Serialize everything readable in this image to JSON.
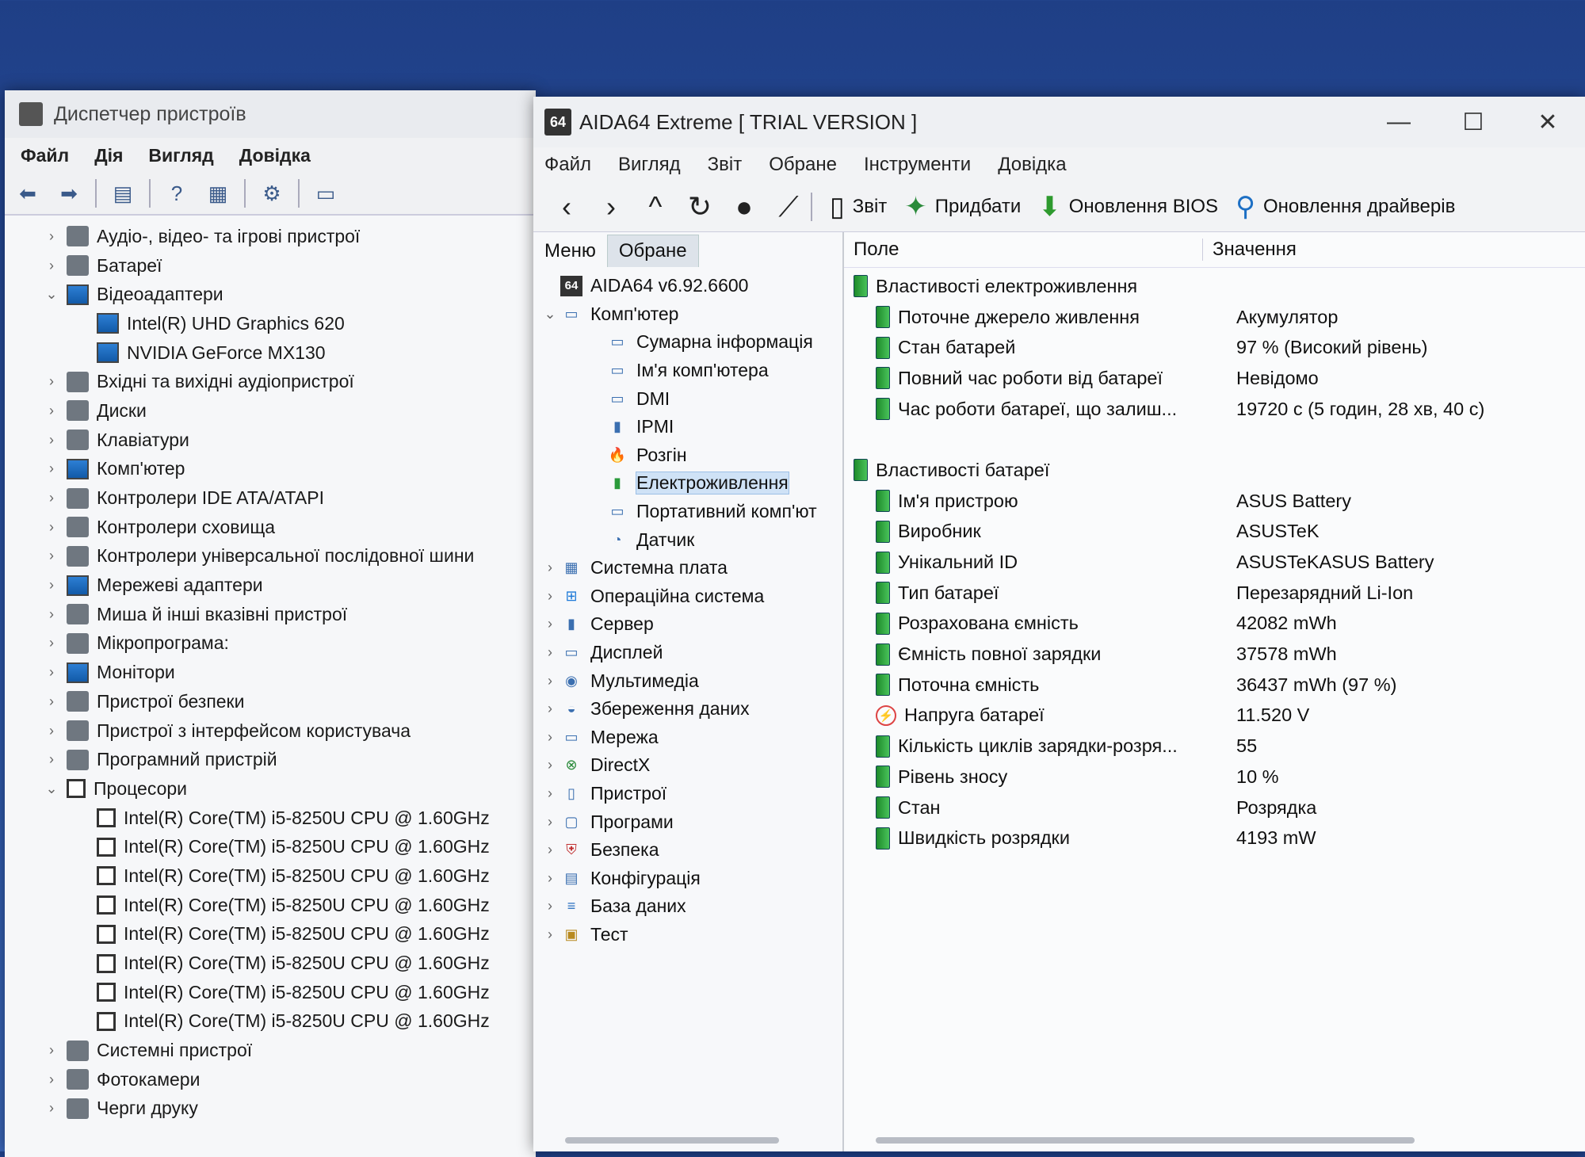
{
  "device_manager": {
    "title": "Диспетчер пристроїв",
    "menu": [
      "Файл",
      "Дія",
      "Вигляд",
      "Довідка"
    ],
    "tree": [
      {
        "label": "Аудіо-, відео- та ігрові пристрої",
        "level": 0,
        "expander": "›",
        "icon": "speaker-icon"
      },
      {
        "label": "Батареї",
        "level": 0,
        "expander": "›",
        "icon": "battery-icon"
      },
      {
        "label": "Відеоадаптери",
        "level": 0,
        "expander": "⌄",
        "icon": "display-adapter-icon"
      },
      {
        "label": "Intel(R) UHD Graphics 620",
        "level": 1,
        "expander": "",
        "icon": "display-adapter-icon"
      },
      {
        "label": "NVIDIA GeForce MX130",
        "level": 1,
        "expander": "",
        "icon": "display-adapter-icon"
      },
      {
        "label": "Вхідні та вихідні аудіопристрої",
        "level": 0,
        "expander": "›",
        "icon": "speaker-icon"
      },
      {
        "label": "Диски",
        "level": 0,
        "expander": "›",
        "icon": "disk-icon"
      },
      {
        "label": "Клавіатури",
        "level": 0,
        "expander": "›",
        "icon": "keyboard-icon"
      },
      {
        "label": "Комп'ютер",
        "level": 0,
        "expander": "›",
        "icon": "computer-icon"
      },
      {
        "label": "Контролери IDE ATA/ATAPI",
        "level": 0,
        "expander": "›",
        "icon": "ide-controller-icon"
      },
      {
        "label": "Контролери сховища",
        "level": 0,
        "expander": "›",
        "icon": "storage-controller-icon"
      },
      {
        "label": "Контролери універсальної послідовної шини",
        "level": 0,
        "expander": "›",
        "icon": "usb-icon"
      },
      {
        "label": "Мережеві адаптери",
        "level": 0,
        "expander": "›",
        "icon": "network-adapter-icon"
      },
      {
        "label": "Миша й інші вказівні пристрої",
        "level": 0,
        "expander": "›",
        "icon": "mouse-icon"
      },
      {
        "label": "Мікропрограма:",
        "level": 0,
        "expander": "›",
        "icon": "firmware-icon"
      },
      {
        "label": "Монітори",
        "level": 0,
        "expander": "›",
        "icon": "monitor-icon"
      },
      {
        "label": "Пристрої безпеки",
        "level": 0,
        "expander": "›",
        "icon": "security-device-icon"
      },
      {
        "label": "Пристрої з інтерфейсом користувача",
        "level": 0,
        "expander": "›",
        "icon": "hid-icon"
      },
      {
        "label": "Програмний пристрій",
        "level": 0,
        "expander": "›",
        "icon": "software-device-icon"
      },
      {
        "label": "Процесори",
        "level": 0,
        "expander": "⌄",
        "icon": "cpu-icon"
      },
      {
        "label": "Intel(R) Core(TM) i5-8250U CPU @ 1.60GHz",
        "level": 1,
        "expander": "",
        "icon": "cpu-icon"
      },
      {
        "label": "Intel(R) Core(TM) i5-8250U CPU @ 1.60GHz",
        "level": 1,
        "expander": "",
        "icon": "cpu-icon"
      },
      {
        "label": "Intel(R) Core(TM) i5-8250U CPU @ 1.60GHz",
        "level": 1,
        "expander": "",
        "icon": "cpu-icon"
      },
      {
        "label": "Intel(R) Core(TM) i5-8250U CPU @ 1.60GHz",
        "level": 1,
        "expander": "",
        "icon": "cpu-icon"
      },
      {
        "label": "Intel(R) Core(TM) i5-8250U CPU @ 1.60GHz",
        "level": 1,
        "expander": "",
        "icon": "cpu-icon"
      },
      {
        "label": "Intel(R) Core(TM) i5-8250U CPU @ 1.60GHz",
        "level": 1,
        "expander": "",
        "icon": "cpu-icon"
      },
      {
        "label": "Intel(R) Core(TM) i5-8250U CPU @ 1.60GHz",
        "level": 1,
        "expander": "",
        "icon": "cpu-icon"
      },
      {
        "label": "Intel(R) Core(TM) i5-8250U CPU @ 1.60GHz",
        "level": 1,
        "expander": "",
        "icon": "cpu-icon"
      },
      {
        "label": "Системні пристрої",
        "level": 0,
        "expander": "›",
        "icon": "system-device-icon"
      },
      {
        "label": "Фотокамери",
        "level": 0,
        "expander": "›",
        "icon": "camera-icon"
      },
      {
        "label": "Черги друку",
        "level": 0,
        "expander": "›",
        "icon": "printer-icon"
      }
    ]
  },
  "aida": {
    "title": "AIDA64 Extreme  [ TRIAL VERSION ]",
    "logo_text": "64",
    "window_controls": [
      "—",
      "☐",
      "✕"
    ],
    "menu": [
      "Файл",
      "Вигляд",
      "Звіт",
      "Обране",
      "Інструменти",
      "Довідка"
    ],
    "toolbar": {
      "report": "Звіт",
      "buy": "Придбати",
      "bios_update": "Оновлення BIOS",
      "driver_update": "Оновлення драйверів"
    },
    "tabs": {
      "menu": "Меню",
      "favorites": "Обране"
    },
    "nav_tree": [
      {
        "label": "AIDA64 v6.92.6600",
        "level": 0,
        "expander": "",
        "icon": "aida64-icon"
      },
      {
        "label": "Комп'ютер",
        "level": 0,
        "expander": "⌄",
        "icon": "computer-icon"
      },
      {
        "label": "Сумарна інформація",
        "level": 1,
        "expander": "",
        "icon": "computer-icon"
      },
      {
        "label": "Ім'я комп'ютера",
        "level": 1,
        "expander": "",
        "icon": "computer-icon"
      },
      {
        "label": "DMI",
        "level": 1,
        "expander": "",
        "icon": "computer-icon"
      },
      {
        "label": "IPMI",
        "level": 1,
        "expander": "",
        "icon": "server-icon"
      },
      {
        "label": "Розгін",
        "level": 1,
        "expander": "",
        "icon": "flame-icon"
      },
      {
        "label": "Електроживлення",
        "level": 1,
        "expander": "",
        "icon": "battery-icon",
        "selected": true
      },
      {
        "label": "Портативний комп'ют",
        "level": 1,
        "expander": "",
        "icon": "computer-icon"
      },
      {
        "label": "Датчик",
        "level": 1,
        "expander": "",
        "icon": "gauge-icon"
      },
      {
        "label": "Системна плата",
        "level": 0,
        "expander": "›",
        "icon": "motherboard-icon"
      },
      {
        "label": "Операційна система",
        "level": 0,
        "expander": "›",
        "icon": "windows-icon"
      },
      {
        "label": "Сервер",
        "level": 0,
        "expander": "›",
        "icon": "server-icon"
      },
      {
        "label": "Дисплей",
        "level": 0,
        "expander": "›",
        "icon": "display-icon"
      },
      {
        "label": "Мультимедіа",
        "level": 0,
        "expander": "›",
        "icon": "multimedia-icon"
      },
      {
        "label": "Збереження даних",
        "level": 0,
        "expander": "›",
        "icon": "storage-icon"
      },
      {
        "label": "Мережа",
        "level": 0,
        "expander": "›",
        "icon": "network-icon"
      },
      {
        "label": "DirectX",
        "level": 0,
        "expander": "›",
        "icon": "directx-icon"
      },
      {
        "label": "Пристрої",
        "level": 0,
        "expander": "›",
        "icon": "devices-icon"
      },
      {
        "label": "Програми",
        "level": 0,
        "expander": "›",
        "icon": "programs-icon"
      },
      {
        "label": "Безпека",
        "level": 0,
        "expander": "›",
        "icon": "shield-icon"
      },
      {
        "label": "Конфігурація",
        "level": 0,
        "expander": "›",
        "icon": "config-icon"
      },
      {
        "label": "База даних",
        "level": 0,
        "expander": "›",
        "icon": "database-icon"
      },
      {
        "label": "Тест",
        "level": 0,
        "expander": "›",
        "icon": "test-icon"
      }
    ],
    "columns": {
      "field": "Поле",
      "value": "Значення"
    },
    "rows": [
      {
        "type": "group",
        "field": "Властивості електроживлення",
        "value": "",
        "icon": "battery-icon"
      },
      {
        "type": "item",
        "field": "Поточне джерело живлення",
        "value": "Акумулятор",
        "icon": "battery-icon"
      },
      {
        "type": "item",
        "field": "Стан батарей",
        "value": "97 % (Високий рівень)",
        "icon": "battery-icon"
      },
      {
        "type": "item",
        "field": "Повний час роботи від батареї",
        "value": "Невідомо",
        "icon": "battery-icon"
      },
      {
        "type": "item",
        "field": "Час роботи батареї, що залиш...",
        "value": "19720 с (5 годин, 28 хв, 40 с)",
        "icon": "battery-icon"
      },
      {
        "type": "blank",
        "field": "",
        "value": "",
        "icon": ""
      },
      {
        "type": "group",
        "field": "Властивості батареї",
        "value": "",
        "icon": "battery-icon"
      },
      {
        "type": "item",
        "field": "Ім'я пристрою",
        "value": "ASUS Battery",
        "icon": "battery-icon"
      },
      {
        "type": "item",
        "field": "Виробник",
        "value": "ASUSTeK",
        "icon": "battery-icon"
      },
      {
        "type": "item",
        "field": "Унікальний ID",
        "value": "ASUSTeKASUS Battery",
        "icon": "battery-icon"
      },
      {
        "type": "item",
        "field": "Тип батареї",
        "value": "Перезарядний Li-Ion",
        "icon": "battery-icon"
      },
      {
        "type": "item",
        "field": "Розрахована ємність",
        "value": "42082 mWh",
        "icon": "battery-icon"
      },
      {
        "type": "item",
        "field": "Ємність повної зарядки",
        "value": "37578 mWh",
        "icon": "battery-icon"
      },
      {
        "type": "item",
        "field": "Поточна ємність",
        "value": "36437 mWh  (97 %)",
        "icon": "battery-icon"
      },
      {
        "type": "item",
        "field": "Напруга батареї",
        "value": "11.520 V",
        "icon": "voltage-icon"
      },
      {
        "type": "item",
        "field": "Кількість циклів зарядки-розря...",
        "value": "55",
        "icon": "battery-icon"
      },
      {
        "type": "item",
        "field": "Рівень зносу",
        "value": "10 %",
        "icon": "battery-icon"
      },
      {
        "type": "item",
        "field": "Стан",
        "value": "Розрядка",
        "icon": "battery-icon"
      },
      {
        "type": "item",
        "field": "Швидкість розрядки",
        "value": "4193 mW",
        "icon": "battery-icon"
      }
    ]
  }
}
